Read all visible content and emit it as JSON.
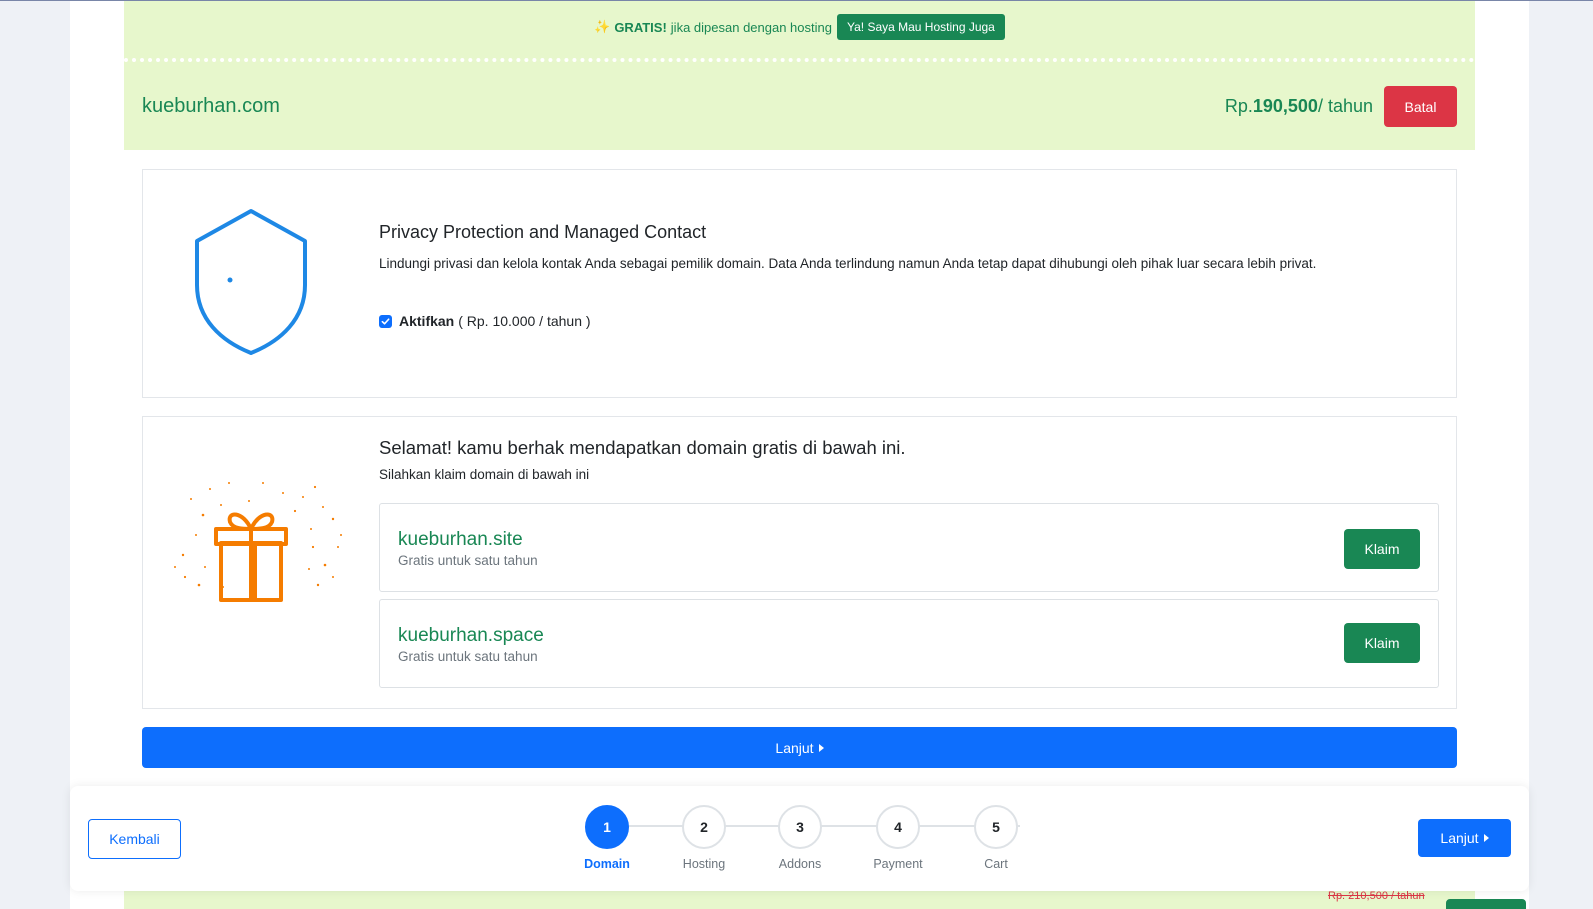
{
  "promo": {
    "bold": "GRATIS!",
    "text": "jika dipesan dengan hosting",
    "button": "Ya! Saya Mau Hosting Juga"
  },
  "selected_domain": {
    "name": "kueburhan.com",
    "price_prefix": "Rp.",
    "price_amount": "190,500",
    "price_suffix": "/ tahun",
    "cancel_label": "Batal"
  },
  "privacy": {
    "title": "Privacy Protection and Managed Contact",
    "description": "Lindungi privasi dan kelola kontak Anda sebagai pemilik domain. Data Anda terlindung namun Anda tetap dapat dihubungi oleh pihak luar secara lebih privat.",
    "checkbox_label": "Aktifkan",
    "checkbox_price": "( Rp. 10.000 / tahun )",
    "checked": true
  },
  "free_domain": {
    "title": "Selamat! kamu berhak mendapatkan domain gratis di bawah ini.",
    "subtitle": "Silahkan klaim domain di bawah ini",
    "items": [
      {
        "name": "kueburhan.site",
        "note": "Gratis untuk satu tahun",
        "button": "Klaim"
      },
      {
        "name": "kueburhan.space",
        "note": "Gratis untuk satu tahun",
        "button": "Klaim"
      }
    ]
  },
  "continue_label": "Lanjut",
  "peek": {
    "strike_price": "Rp. 210,500 / tahun"
  },
  "stepper": {
    "back_label": "Kembali",
    "next_label": "Lanjut",
    "active_index": 0,
    "steps": [
      {
        "number": "1",
        "label": "Domain"
      },
      {
        "number": "2",
        "label": "Hosting"
      },
      {
        "number": "3",
        "label": "Addons"
      },
      {
        "number": "4",
        "label": "Payment"
      },
      {
        "number": "5",
        "label": "Cart"
      }
    ]
  },
  "colors": {
    "green": "#198754",
    "blue": "#0d6efd",
    "red": "#dc3545",
    "orange": "#f57c00",
    "header_bg": "#e7f7cc"
  }
}
